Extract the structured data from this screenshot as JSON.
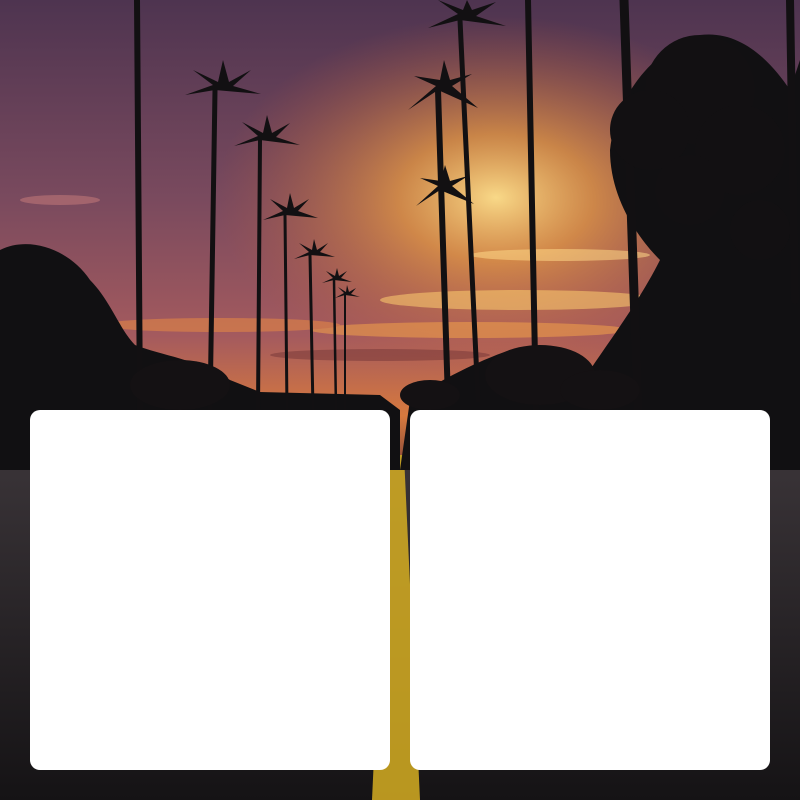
{
  "scene": {
    "subject": "sunset-palm-road-photo",
    "colors": {
      "sky_top": "#5a3a52",
      "sky_mid": "#8a4e5e",
      "sky_glow": "#e58a3c",
      "sun": "#ffd27a",
      "silhouette": "#121012",
      "road": "#2b2a2c",
      "road_line": "#d9b320"
    }
  },
  "panels": [
    {
      "name": "left-panel",
      "background": "#ffffff"
    },
    {
      "name": "right-panel",
      "background": "#ffffff"
    }
  ]
}
